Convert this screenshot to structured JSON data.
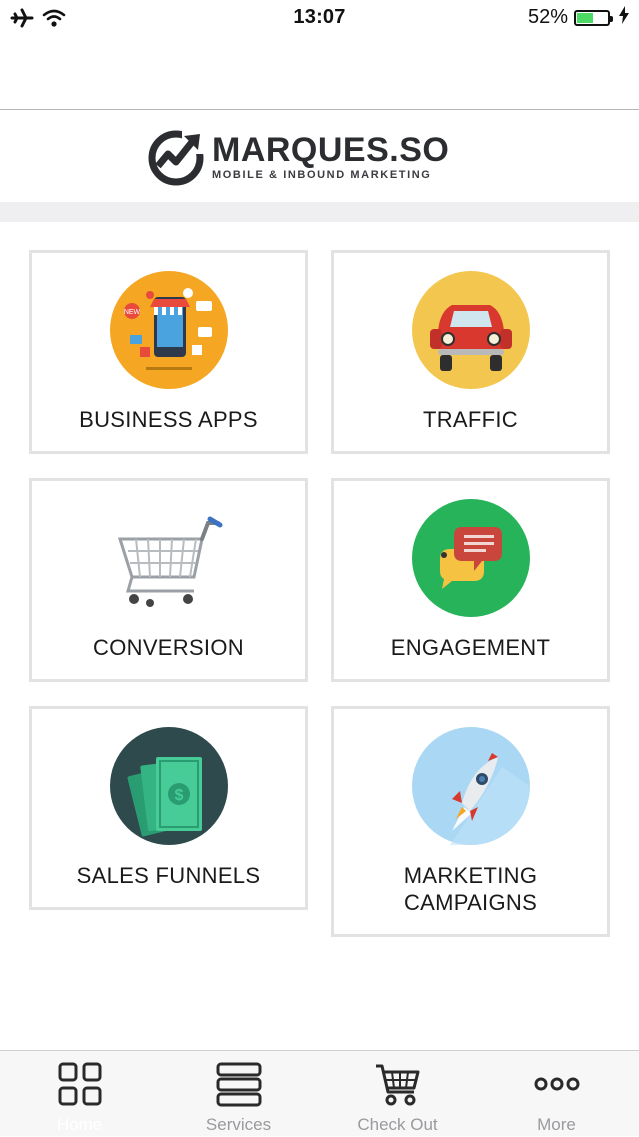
{
  "status_bar": {
    "time": "13:07",
    "battery_percent": "52%",
    "battery_level": 0.52,
    "icons": [
      "airplane-icon",
      "wifi-icon",
      "battery-icon",
      "charging-icon"
    ]
  },
  "logo": {
    "brand": "MARQUES.SO",
    "tagline": "MOBILE & INBOUND MARKETING"
  },
  "tiles": [
    {
      "label": "BUSINESS APPS",
      "icon": "business-apps-icon"
    },
    {
      "label": "TRAFFIC",
      "icon": "car-icon"
    },
    {
      "label": "CONVERSION",
      "icon": "shopping-cart-icon"
    },
    {
      "label": "ENGAGEMENT",
      "icon": "chat-bubbles-icon"
    },
    {
      "label": "SALES FUNNELS",
      "icon": "money-icon"
    },
    {
      "label": "MARKETING\nCAMPAIGNS",
      "icon": "rocket-icon"
    }
  ],
  "tab_bar": {
    "tabs": [
      {
        "label": "Home",
        "icon": "grid-icon",
        "active": true
      },
      {
        "label": "Services",
        "icon": "stack-icon",
        "active": false
      },
      {
        "label": "Check Out",
        "icon": "cart-icon",
        "active": false
      },
      {
        "label": "More",
        "icon": "more-dots-icon",
        "active": false
      }
    ]
  },
  "colors": {
    "orange": "#f5a623",
    "gold": "#f3c64f",
    "green": "#27b35a",
    "dark_teal": "#2e4a4c",
    "light_blue": "#a9d7f4",
    "car_red": "#d9382f",
    "battery_green": "#4cd964"
  }
}
